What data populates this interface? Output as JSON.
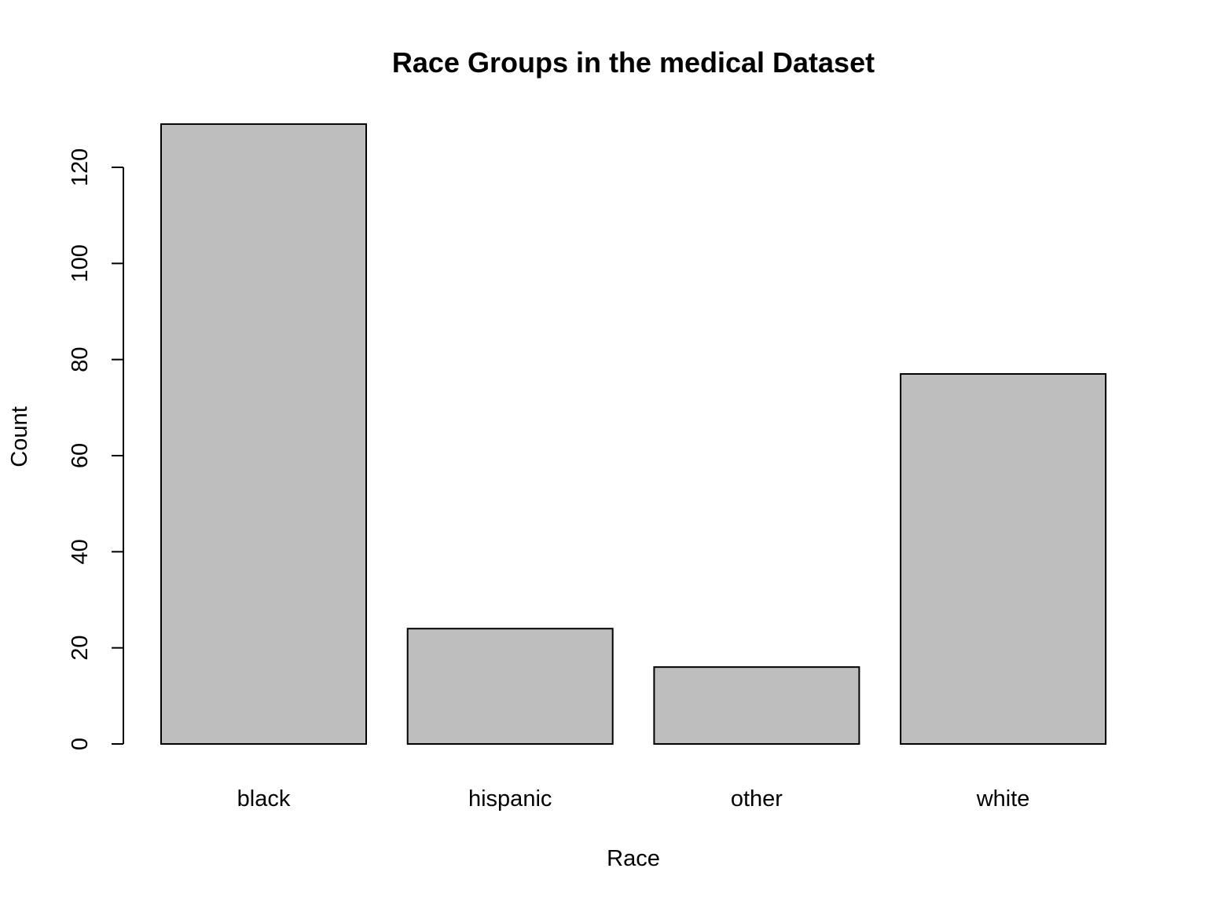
{
  "chart_data": {
    "type": "bar",
    "title": "Race Groups in the medical Dataset",
    "xlabel": "Race",
    "ylabel": "Count",
    "categories": [
      "black",
      "hispanic",
      "other",
      "white"
    ],
    "values": [
      129,
      24,
      16,
      77
    ],
    "ylim": [
      0,
      129
    ],
    "yticks": [
      0,
      20,
      40,
      60,
      80,
      100,
      120
    ],
    "ytick_labels": [
      "0",
      "20",
      "40",
      "60",
      "80",
      "100",
      "120"
    ],
    "bar_color": "#bebebe",
    "bar_border_color": "#000000",
    "grid": false,
    "legend": "none"
  }
}
